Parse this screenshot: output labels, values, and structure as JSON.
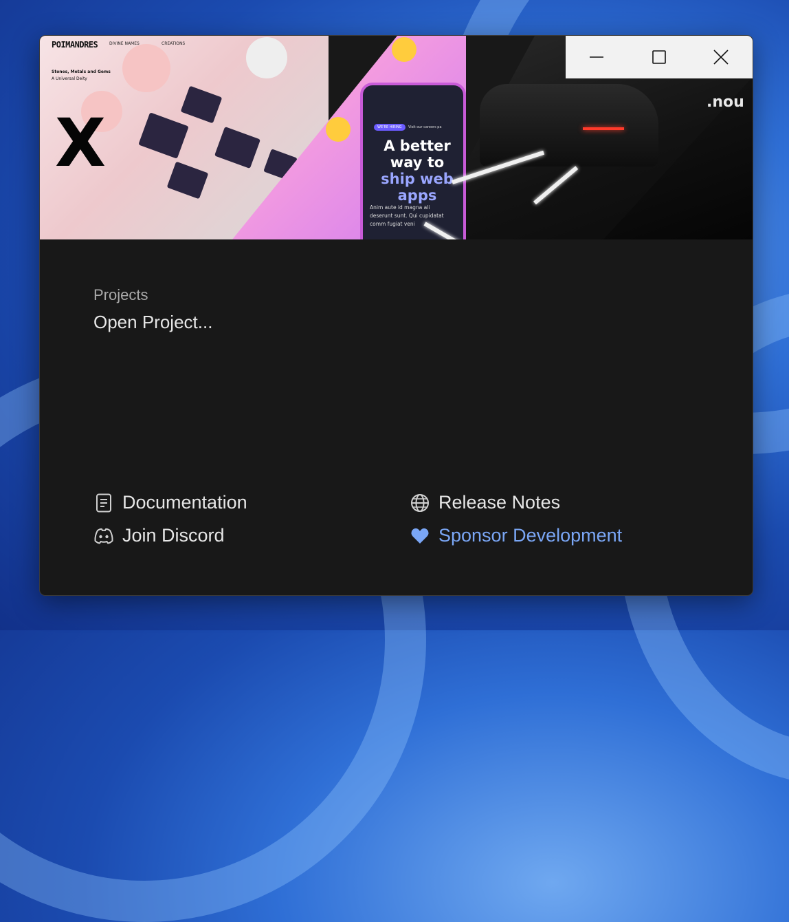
{
  "hero": {
    "brand": "POIMANDRES",
    "nav": [
      "DIVINE NAMES",
      "CREATIONS"
    ],
    "subtitle": "Stones, Metals and Gems",
    "tagline": "A Universal Deity",
    "phone_badge": "WE'RE HIRING",
    "phone_careers": "Visit our careers pa",
    "phone_headline_1": "A better way to",
    "phone_headline_2": "ship web apps",
    "phone_body": "Anim aute id magna ali deserunt sunt. Qui cupidatat comm fugiat veni",
    "overlay_text": ".nou"
  },
  "window_controls": {
    "minimize_icon": "minimize-icon",
    "maximize_icon": "maximize-icon",
    "close_icon": "close-icon"
  },
  "projects": {
    "label": "Projects",
    "open_label": "Open Project..."
  },
  "links": {
    "documentation": {
      "label": "Documentation",
      "icon": "document-icon"
    },
    "release_notes": {
      "label": "Release Notes",
      "icon": "globe-icon"
    },
    "discord": {
      "label": "Join Discord",
      "icon": "discord-icon"
    },
    "sponsor": {
      "label": "Sponsor Development",
      "icon": "heart-icon"
    }
  },
  "colors": {
    "window_bg": "#181818",
    "text": "#e6e6e6",
    "muted": "#a9a9a9",
    "accent": "#7aa6f5"
  }
}
